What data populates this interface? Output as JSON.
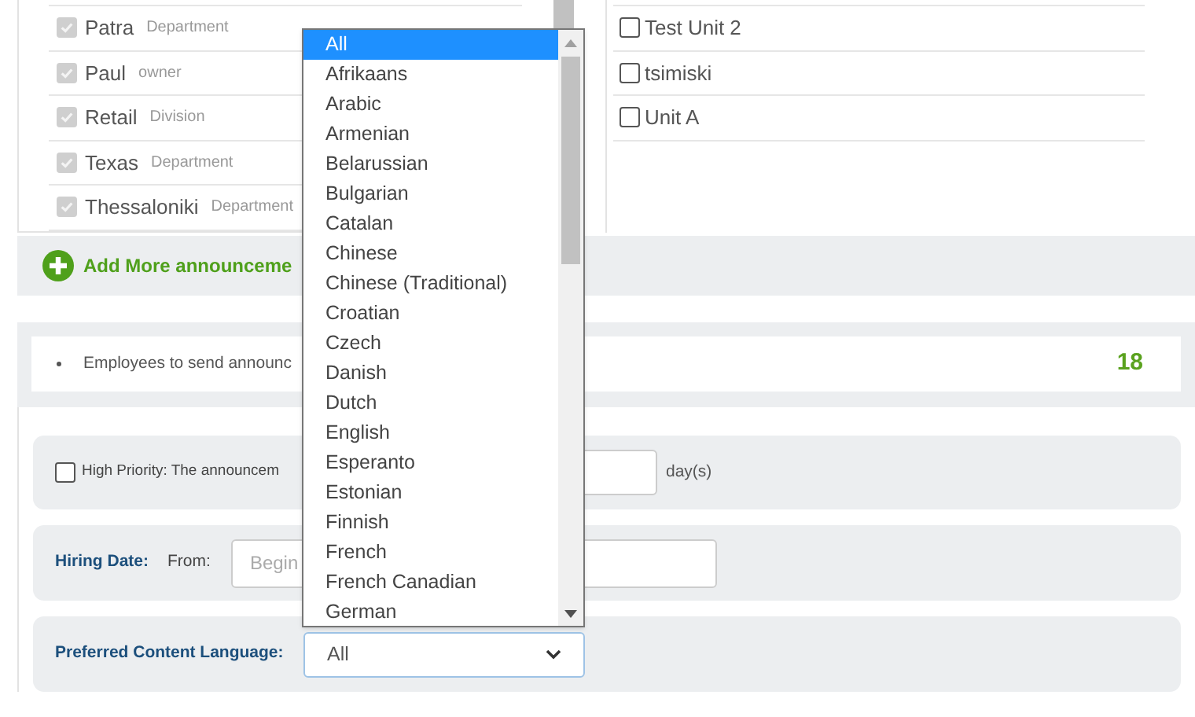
{
  "left_list": {
    "items": [
      {
        "name": "Patra",
        "type": "Department",
        "checked": true,
        "disabled": true
      },
      {
        "name": "Paul",
        "type": "owner",
        "checked": true,
        "disabled": true
      },
      {
        "name": "Retail",
        "type": "Division",
        "checked": true,
        "disabled": true
      },
      {
        "name": "Texas",
        "type": "Department",
        "checked": true,
        "disabled": true
      },
      {
        "name": "Thessaloniki",
        "type": "Department",
        "checked": true,
        "disabled": true
      }
    ]
  },
  "right_list": {
    "items": [
      {
        "name": "Test Unit 2",
        "checked": false
      },
      {
        "name": "tsimiski",
        "checked": false
      },
      {
        "name": "Unit A",
        "checked": false
      }
    ]
  },
  "add_more": {
    "label": "Add More announceme"
  },
  "summary": {
    "text": "Employees to send announc",
    "count": "18"
  },
  "high_priority": {
    "checked": false,
    "label": "High Priority: The announcem",
    "unit": "day(s)"
  },
  "hiring_date": {
    "label": "Hiring Date:",
    "from_label": "From:",
    "placeholder": "Begin"
  },
  "language": {
    "label": "Preferred Content Language:",
    "value": "All",
    "options": [
      {
        "label": "All",
        "selected": true
      },
      {
        "label": "Afrikaans",
        "selected": false
      },
      {
        "label": "Arabic",
        "selected": false
      },
      {
        "label": "Armenian",
        "selected": false
      },
      {
        "label": "Belarussian",
        "selected": false
      },
      {
        "label": "Bulgarian",
        "selected": false
      },
      {
        "label": "Catalan",
        "selected": false
      },
      {
        "label": "Chinese",
        "selected": false
      },
      {
        "label": "Chinese (Traditional)",
        "selected": false
      },
      {
        "label": "Croatian",
        "selected": false
      },
      {
        "label": "Czech",
        "selected": false
      },
      {
        "label": "Danish",
        "selected": false
      },
      {
        "label": "Dutch",
        "selected": false
      },
      {
        "label": "English",
        "selected": false
      },
      {
        "label": "Esperanto",
        "selected": false
      },
      {
        "label": "Estonian",
        "selected": false
      },
      {
        "label": "Finnish",
        "selected": false
      },
      {
        "label": "French",
        "selected": false
      },
      {
        "label": "French Canadian",
        "selected": false
      },
      {
        "label": "German",
        "selected": false
      }
    ]
  }
}
